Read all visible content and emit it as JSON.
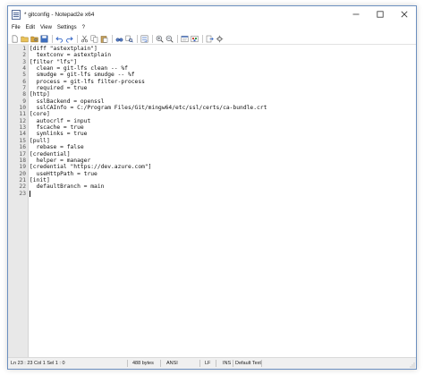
{
  "window": {
    "title": "* gitconfig - Notepad2e x64"
  },
  "menu": [
    {
      "label": "File"
    },
    {
      "label": "Edit"
    },
    {
      "label": "View"
    },
    {
      "label": "Settings"
    },
    {
      "label": "?"
    }
  ],
  "toolbar": [
    {
      "icon": "new-file-icon"
    },
    {
      "icon": "open-folder-icon"
    },
    {
      "icon": "browse-icon"
    },
    {
      "icon": "save-icon"
    },
    {
      "sep": true
    },
    {
      "icon": "undo-icon"
    },
    {
      "icon": "redo-icon"
    },
    {
      "sep": true
    },
    {
      "icon": "cut-icon"
    },
    {
      "icon": "copy-icon"
    },
    {
      "icon": "paste-icon"
    },
    {
      "sep": true
    },
    {
      "icon": "find-icon"
    },
    {
      "icon": "replace-icon"
    },
    {
      "sep": true
    },
    {
      "icon": "word-wrap-icon"
    },
    {
      "sep": true
    },
    {
      "icon": "zoom-in-icon"
    },
    {
      "icon": "zoom-out-icon"
    },
    {
      "sep": true
    },
    {
      "icon": "scheme-icon"
    },
    {
      "icon": "customize-scheme-icon"
    },
    {
      "sep": true
    },
    {
      "icon": "exit-icon"
    },
    {
      "icon": "save-settings-icon"
    }
  ],
  "editor": {
    "lines": [
      "[diff \"astextplain\"]",
      "  textconv = astextplain",
      "[filter \"lfs\"]",
      "  clean = git-lfs clean -- %f",
      "  smudge = git-lfs smudge -- %f",
      "  process = git-lfs filter-process",
      "  required = true",
      "[http]",
      "  sslBackend = openssl",
      "  sslCAInfo = C:/Program Files/Git/mingw64/etc/ssl/certs/ca-bundle.crt",
      "[core]",
      "  autocrlf = input",
      "  fscache = true",
      "  symlinks = true",
      "[pull]",
      "  rebase = false",
      "[credential]",
      "  helper = manager",
      "[credential \"https://dev.azure.com\"]",
      "  useHttpPath = true",
      "[init]",
      "  defaultBranch = main",
      ""
    ],
    "caret_line": 23
  },
  "status": {
    "position": "Ln 23 : 23   Col 1   Sel 1 : 0",
    "size": "488 bytes",
    "encoding": "ANSI",
    "eol": "LF",
    "mode": "INS",
    "scheme": "Default Text"
  },
  "colors": {
    "gutter": "#e8e8e8",
    "border": "#6b8fbf",
    "statusbar": "#f0f0f0"
  }
}
